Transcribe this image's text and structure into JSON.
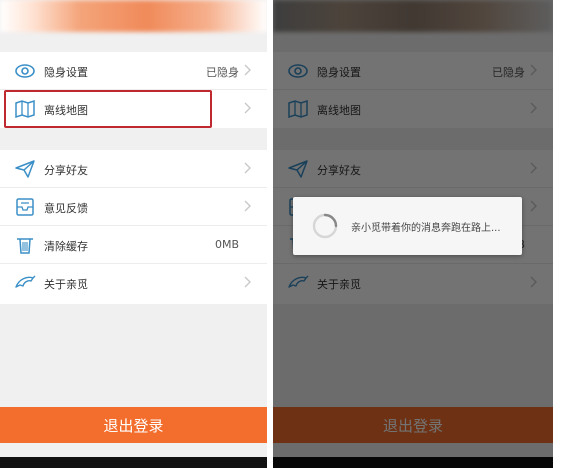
{
  "settings": {
    "group1": [
      {
        "label": "隐身设置",
        "value": "已隐身",
        "icon": "eye-icon"
      },
      {
        "label": "离线地图",
        "value": "",
        "icon": "map-icon"
      }
    ],
    "group2": [
      {
        "label": "分享好友",
        "value": "",
        "icon": "paper-plane-icon"
      },
      {
        "label": "意见反馈",
        "value": "",
        "icon": "inbox-icon"
      },
      {
        "label": "清除缓存",
        "value": "0MB",
        "icon": "trash-icon"
      },
      {
        "label": "关于亲觅",
        "value": "",
        "icon": "dolphin-icon"
      }
    ]
  },
  "logout_label": "退出登录",
  "loading_toast": {
    "text": "亲小觅带着你的消息奔跑在路上..."
  },
  "colors": {
    "accent": "#f36d2c",
    "highlight": "#c0282f",
    "icon": "#3a8fc7"
  }
}
